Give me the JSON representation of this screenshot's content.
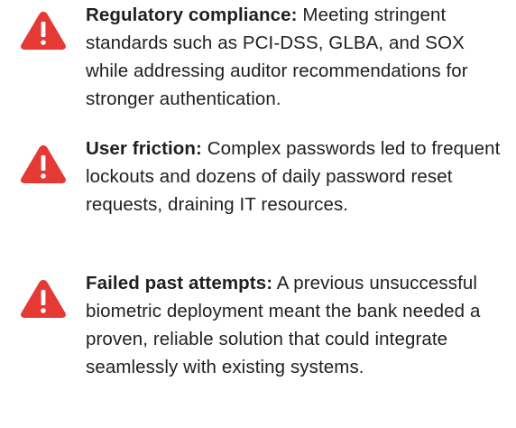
{
  "colors": {
    "warning_red": "#E53935",
    "text": "#1f1f1f",
    "background": "#ffffff"
  },
  "items": [
    {
      "icon": "warning-triangle-icon",
      "label": "Regulatory compliance:",
      "body": " Meeting stringent standards such as PCI-DSS, GLBA, and SOX while addressing auditor recommendations for stronger authentication."
    },
    {
      "icon": "warning-triangle-icon",
      "label": "User friction:",
      "body": " Complex passwords led to frequent lockouts and dozens of daily password reset requests, draining IT resources."
    },
    {
      "icon": "warning-triangle-icon",
      "label": "Failed past attempts:",
      "body": " A previous unsuccessful biometric deployment meant the bank needed a proven, reliable solution that could integrate seamlessly with existing systems."
    }
  ]
}
